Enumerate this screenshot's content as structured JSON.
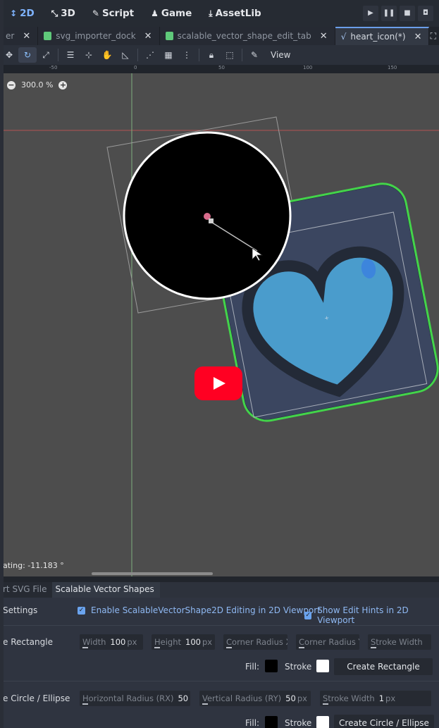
{
  "workspace": {
    "items": [
      {
        "icon": "2d-icon",
        "glyph": "↕",
        "label": "2D"
      },
      {
        "icon": "3d-icon",
        "glyph": "⤡",
        "label": "3D"
      },
      {
        "icon": "script-icon",
        "glyph": "✎",
        "label": "Script"
      },
      {
        "icon": "game-icon",
        "glyph": "♟",
        "label": "Game"
      },
      {
        "icon": "assetlib-icon",
        "glyph": "⤓",
        "label": "AssetLib"
      }
    ]
  },
  "tabs": [
    {
      "label": "er",
      "doc_color": "",
      "active": false
    },
    {
      "label": "svg_importer_dock",
      "doc_color": "#5fc97a",
      "active": false
    },
    {
      "label": "scalable_vector_shape_edit_tab",
      "doc_color": "#5fc97a",
      "active": false
    },
    {
      "label": "heart_icon(*)",
      "doc_color": "",
      "active": true
    }
  ],
  "toolbar": {
    "view_label": "View"
  },
  "ruler": {
    "ticks": [
      "-50",
      "0",
      "50",
      "100",
      "150"
    ]
  },
  "viewport": {
    "zoom_label": "300.0 %",
    "rotating_text": "ating: -11.183 °"
  },
  "dock": {
    "tabs": [
      {
        "label": "rt SVG File",
        "active": false
      },
      {
        "label": "Scalable Vector Shapes",
        "active": true
      }
    ],
    "settings": {
      "label": "Settings",
      "enable_editing": "Enable ScalableVectorShape2D Editing in 2D Viewport",
      "show_hints": "Show Edit Hints in 2D Viewport"
    },
    "rectangle": {
      "label": "e Rectangle",
      "width_label": "Width",
      "width_value": "100",
      "width_unit": "px",
      "height_label": "Height",
      "height_value": "100",
      "height_unit": "px",
      "rx_label": "Corner Radius X",
      "ry_label": "Corner Radius Y",
      "stroke_width_label": "Stroke Width",
      "fill_label": "Fill:",
      "stroke_label": "Stroke",
      "create_label": "Create Rectangle"
    },
    "ellipse": {
      "label": "e Circle / Ellipse",
      "rx_label": "Horizontal Radius (RX)",
      "rx_value": "50",
      "rx_unit": "p",
      "ry_label": "Vertical Radius (RY)",
      "ry_value": "50",
      "ry_unit": "px",
      "stroke_width_label": "Stroke Width",
      "stroke_width_value": "1",
      "stroke_width_unit": "px",
      "fill_label": "Fill:",
      "stroke_label": "Stroke",
      "create_label": "Create Circle / Ellipse"
    }
  },
  "colors": {
    "accent": "#6b9eea",
    "canvas_bg": "#4d4d4d",
    "heart_fill": "#4a9ccc",
    "selection_outline": "#3ddc4a",
    "play_button": "#ff0022"
  }
}
